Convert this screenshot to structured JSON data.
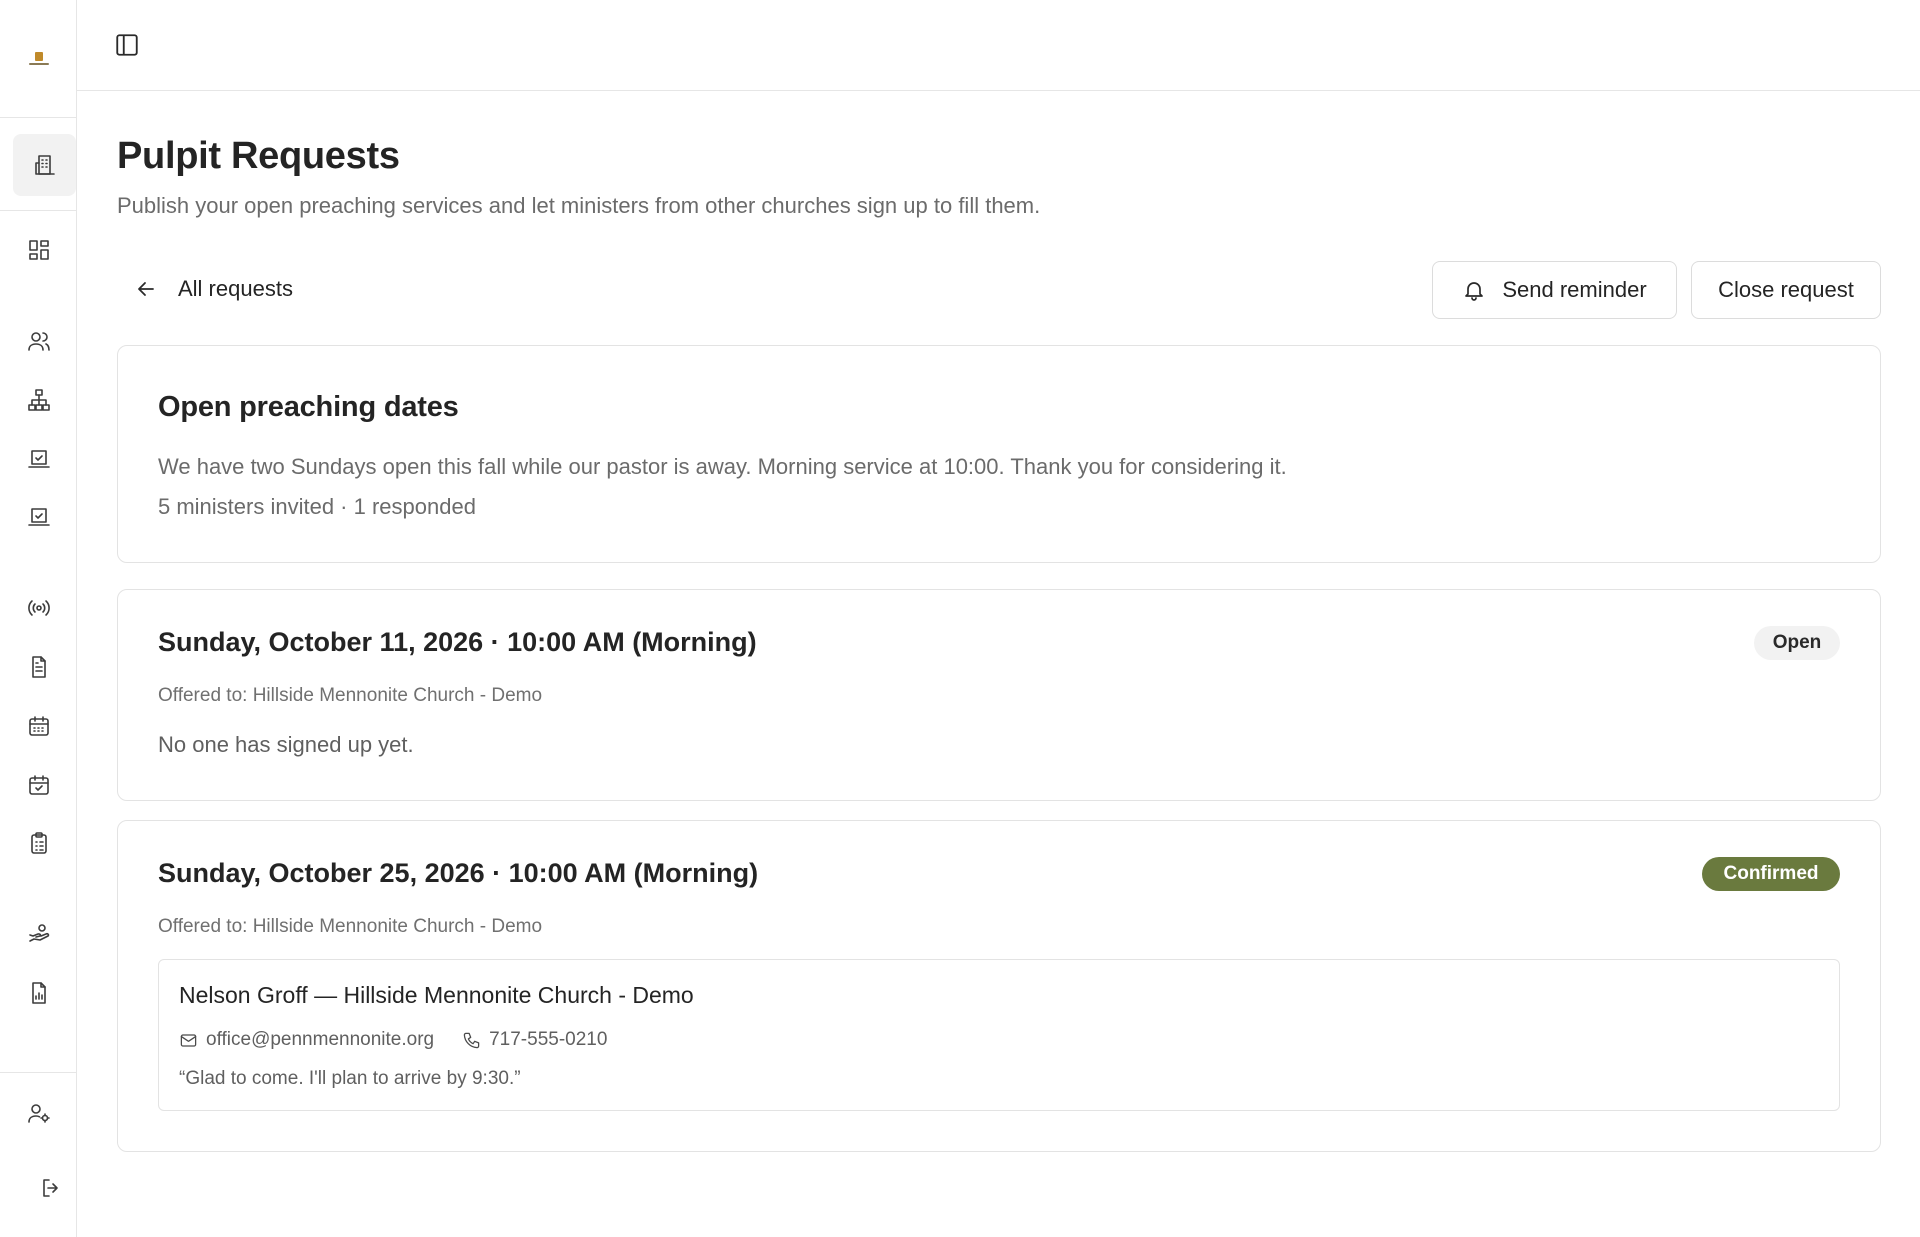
{
  "page": {
    "title": "Pulpit Requests",
    "subtitle": "Publish your open preaching services and let ministers from other churches sign up to fill them."
  },
  "nav": {
    "back_label": "All requests"
  },
  "actions": {
    "send_reminder": "Send reminder",
    "close_request": "Close request"
  },
  "request": {
    "title": "Open preaching dates",
    "message": "We have two Sundays open this fall while our pastor is away. Morning service at 10:00. Thank you for considering it.",
    "stats": "5 ministers invited · 1 responded"
  },
  "dates": [
    {
      "title": "Sunday, October 11, 2026 · 10:00 AM (Morning)",
      "status": "Open",
      "offered_to": "Offered to: Hillside Mennonite Church - Demo",
      "empty_text": "No one has signed up yet."
    },
    {
      "title": "Sunday, October 25, 2026 · 10:00 AM (Morning)",
      "status": "Confirmed",
      "offered_to": "Offered to: Hillside Mennonite Church - Demo",
      "response": {
        "name": "Nelson Groff — Hillside Mennonite Church - Demo",
        "email": "office@pennmennonite.org",
        "phone": "717-555-0210",
        "note": "“Glad to come. I'll plan to arrive by 9:30.”"
      }
    }
  ],
  "sidebar_icons": [
    "churches-icon",
    "dashboard-icon",
    "people-icon",
    "org-chart-icon",
    "tasks-icon",
    "checklist-icon",
    "broadcast-icon",
    "document-icon",
    "calendar-icon",
    "calendar-check-icon",
    "clipboard-icon",
    "offering-icon",
    "report-icon",
    "user-settings-icon",
    "logout-icon"
  ],
  "colors": {
    "confirmed_badge": "#6a7a3e",
    "open_badge": "#f2f2f2",
    "border": "#e3e3e3",
    "muted_text": "#6b6b6b"
  }
}
